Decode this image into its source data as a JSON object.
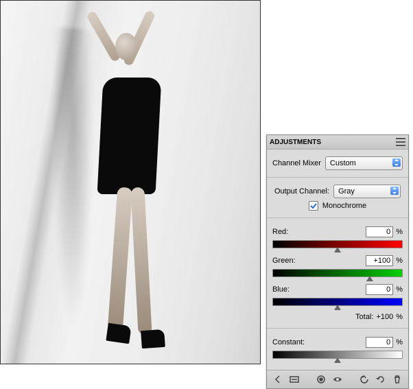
{
  "panel": {
    "title": "ADJUSTMENTS",
    "adjustment_label": "Channel Mixer",
    "preset_value": "Custom",
    "output_channel_label": "Output Channel:",
    "output_channel_value": "Gray",
    "monochrome_label": "Monochrome",
    "monochrome_checked": true,
    "sliders": {
      "red": {
        "label": "Red:",
        "value": "0",
        "pos_pct": 50
      },
      "green": {
        "label": "Green:",
        "value": "+100",
        "pos_pct": 75
      },
      "blue": {
        "label": "Blue:",
        "value": "0",
        "pos_pct": 50
      }
    },
    "total_label": "Total:",
    "total_value": "+100",
    "constant": {
      "label": "Constant:",
      "value": "0",
      "pos_pct": 50
    },
    "percent_glyph": "%"
  }
}
